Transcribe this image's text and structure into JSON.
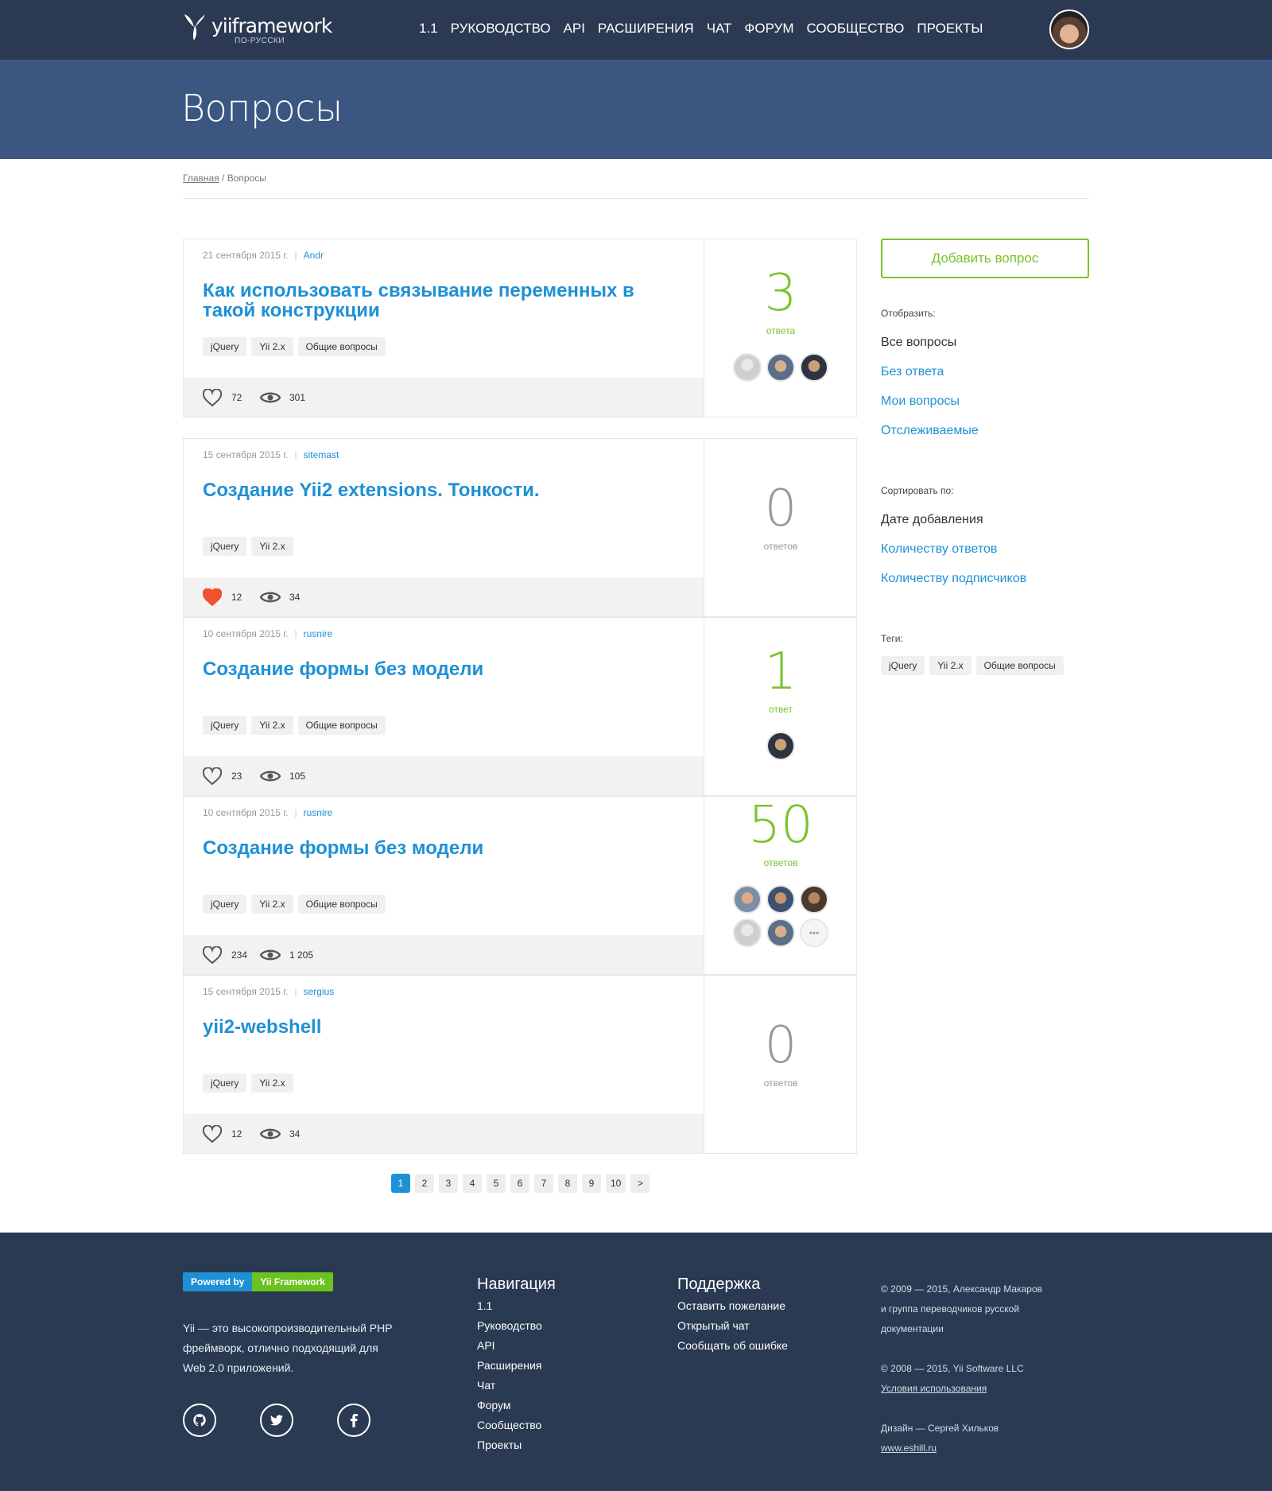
{
  "brand": {
    "name": "yiiframework",
    "sub": "ПО-РУССКИ"
  },
  "nav": [
    "1.1",
    "РУКОВОДСТВО",
    "API",
    "РАСШИРЕНИЯ",
    "ЧАТ",
    "ФОРУМ",
    "СООБЩЕСТВО",
    "ПРОЕКТЫ"
  ],
  "page_title": "Вопросы",
  "breadcrumb": {
    "home": "Главная",
    "sep": " / ",
    "current": "Вопросы"
  },
  "questions": [
    {
      "date": "21 сентября 2015 г.",
      "author": "Andr",
      "title": "Как использовать связывание переменных в такой конструкции",
      "tags": [
        "jQuery",
        "Yii 2.x",
        "Общие вопросы"
      ],
      "likes": "72",
      "liked": false,
      "views": "301",
      "answers": "3",
      "answers_label": "ответа",
      "answered": true,
      "avatars": 3,
      "more": false
    },
    {
      "date": "15 сентября 2015 г.",
      "author": "sitemast",
      "title": "Создание Yii2 extensions. Тонкости.",
      "tags": [
        "jQuery",
        "Yii 2.x"
      ],
      "likes": "12",
      "liked": true,
      "views": "34",
      "answers": "0",
      "answers_label": "ответов",
      "answered": false,
      "avatars": 0,
      "more": false
    },
    {
      "date": "10 сентября 2015 г.",
      "author": "rusnire",
      "title": "Создание формы без модели",
      "tags": [
        "jQuery",
        "Yii 2.x",
        "Общие вопросы"
      ],
      "likes": "23",
      "liked": false,
      "views": "105",
      "answers": "1",
      "answers_label": "ответ",
      "answered": true,
      "avatars": 1,
      "more": false
    },
    {
      "date": "10 сентября 2015 г.",
      "author": "rusnire",
      "title": "Создание формы без модели",
      "tags": [
        "jQuery",
        "Yii 2.x",
        "Общие вопросы"
      ],
      "likes": "234",
      "liked": false,
      "views": "1 205",
      "answers": "50",
      "answers_label": "ответов",
      "answered": true,
      "avatars": 5,
      "more": true
    },
    {
      "date": "15 сентября 2015 г.",
      "author": "sergius",
      "title": "yii2-webshell",
      "tags": [
        "jQuery",
        "Yii 2.x"
      ],
      "likes": "12",
      "liked": false,
      "views": "34",
      "answers": "0",
      "answers_label": "ответов",
      "answered": false,
      "avatars": 0,
      "more": false
    }
  ],
  "more_label": "•••",
  "pagination": {
    "pages": [
      "1",
      "2",
      "3",
      "4",
      "5",
      "6",
      "7",
      "8",
      "9",
      "10"
    ],
    "next": ">",
    "current": "1"
  },
  "sidebar": {
    "add_button": "Добавить вопрос",
    "show_title": "Отобразить:",
    "show_items": [
      "Все вопросы",
      "Без ответа",
      "Мои вопросы",
      "Отслеживаемые"
    ],
    "sort_title": "Сортировать по:",
    "sort_items": [
      "Дате добавления",
      "Количеству ответов",
      "Количеству подписчиков"
    ],
    "tags_title": "Теги:",
    "tags": [
      "jQuery",
      "Yii 2.x",
      "Общие вопросы"
    ]
  },
  "footer": {
    "badge_left": "Powered by",
    "badge_right": "Yii Framework",
    "description": "Yii — это высокопроизводительный PHP фреймворк, отлично подходящий для Web 2.0 приложений.",
    "nav_title": "Навигация",
    "nav_links": [
      "1.1",
      "Руководство",
      "API",
      "Расширения",
      "Чат",
      "Форум",
      "Сообщество",
      "Проекты"
    ],
    "support_title": "Поддержка",
    "support_links": [
      "Оставить пожелание",
      "Открытый чат",
      "Сообщать об ошибке"
    ],
    "copy1": "© 2009 — 2015, Александр Макаров",
    "copy2": "и группа переводчиков русской",
    "copy3": "документации",
    "copy4": "© 2008 — 2015, Yii Software LLC",
    "terms": "Условия использования",
    "design": "Дизайн — Сергей Хильков",
    "design_link": "www.eshill.ru"
  },
  "colors": {
    "header": "#2b3a52",
    "banner": "#3b5680",
    "link": "#1e90d6",
    "green": "#79c32c",
    "heart_active": "#f0522d"
  }
}
